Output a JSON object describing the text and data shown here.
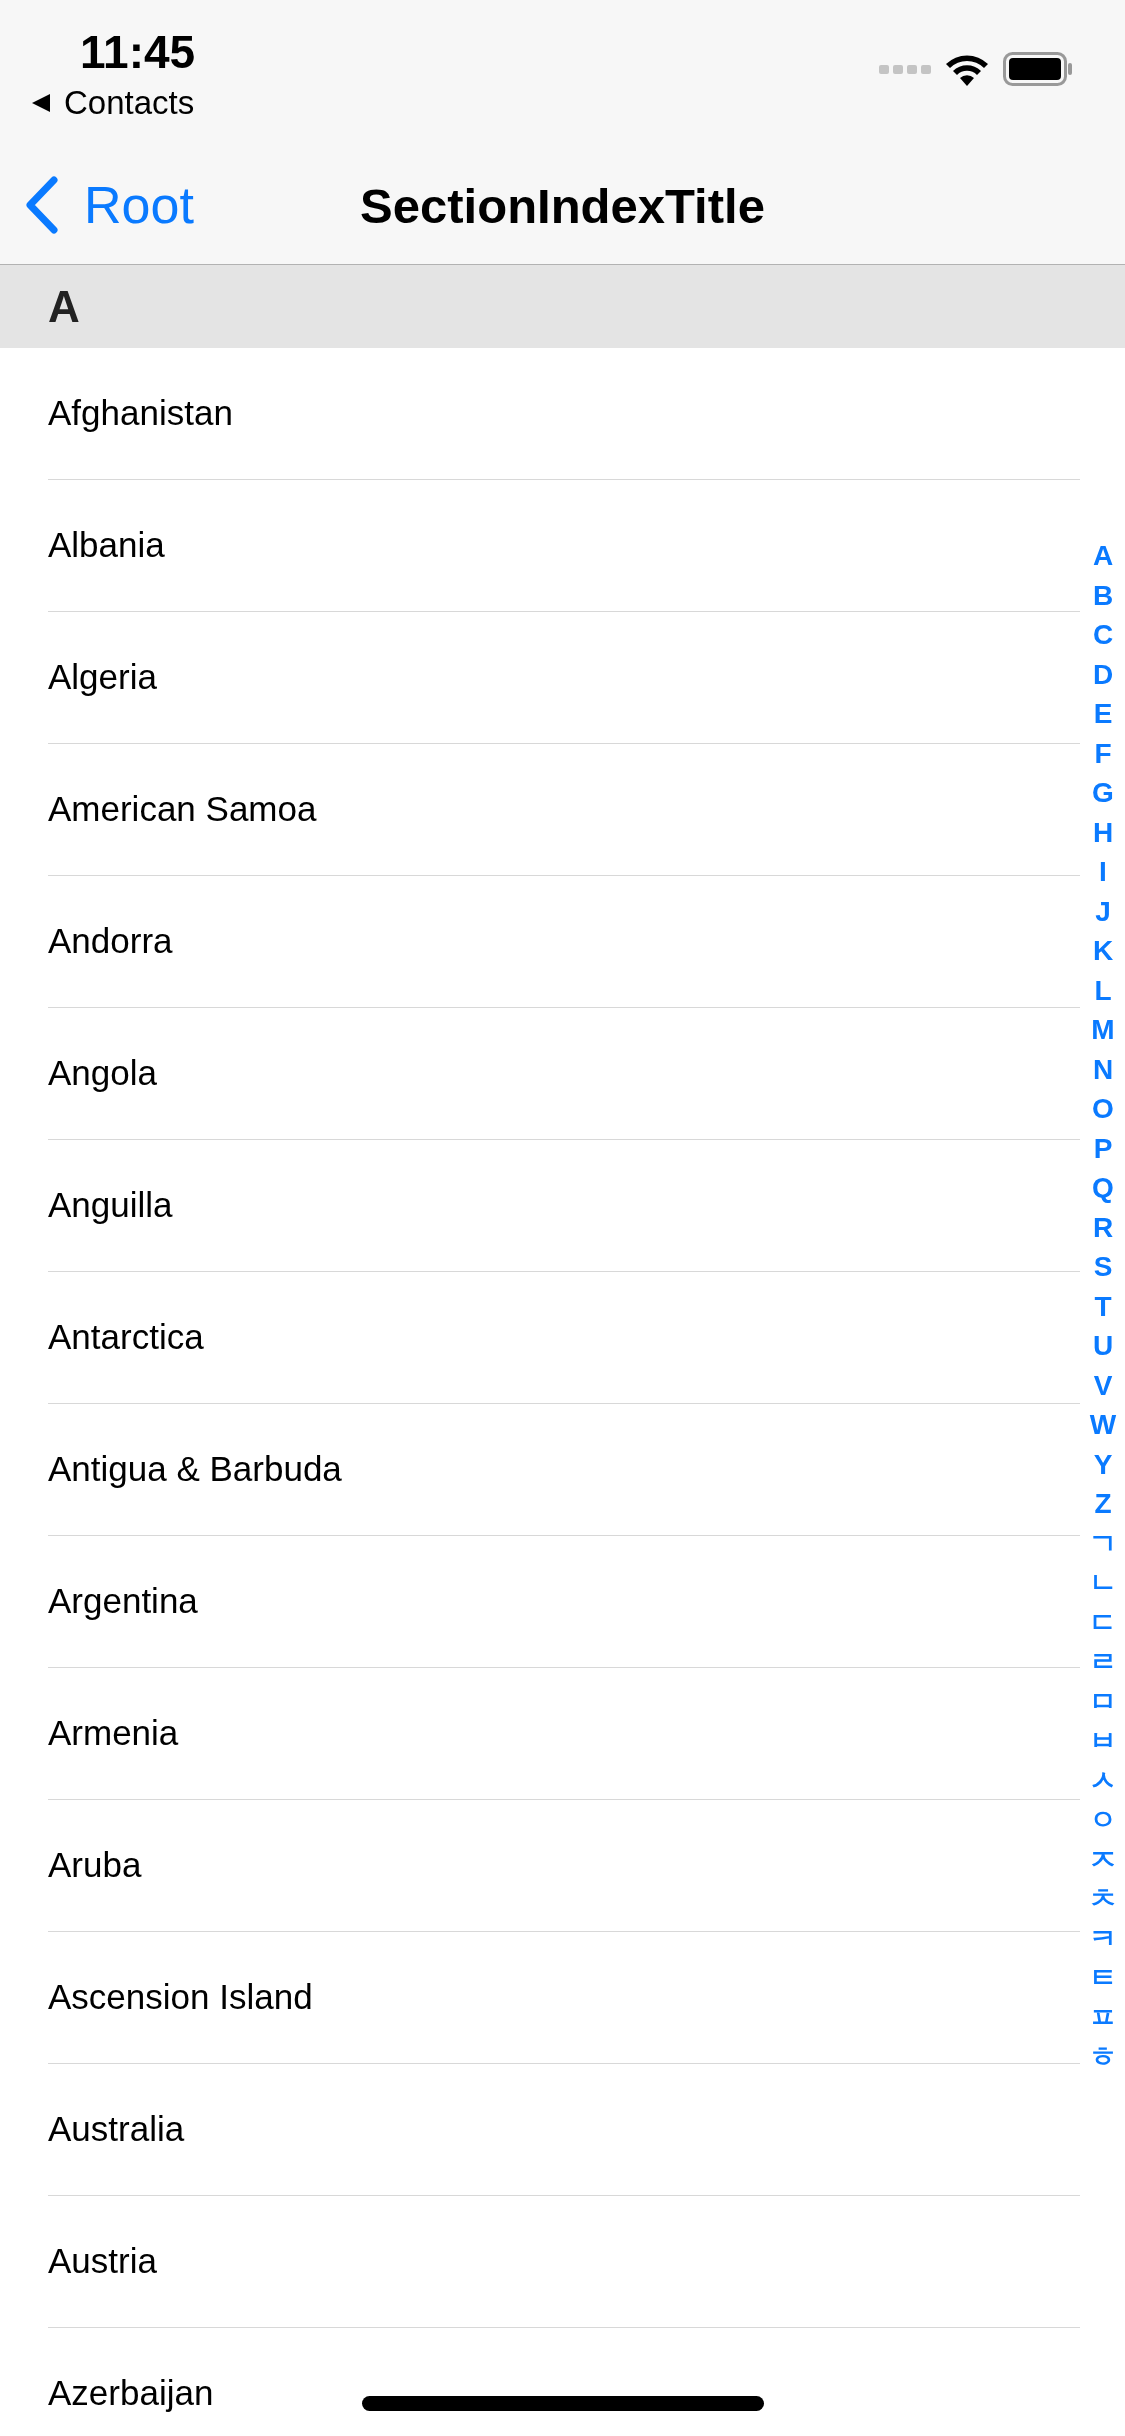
{
  "status_bar": {
    "time": "11:45",
    "back_app": "Contacts"
  },
  "nav_bar": {
    "back_label": "Root",
    "title": "SectionIndexTitle"
  },
  "sections": [
    {
      "header": "A",
      "rows": [
        "Afghanistan",
        "Albania",
        "Algeria",
        "American Samoa",
        "Andorra",
        "Angola",
        "Anguilla",
        "Antarctica",
        "Antigua & Barbuda",
        "Argentina",
        "Armenia",
        "Aruba",
        "Ascension Island",
        "Australia",
        "Austria",
        "Azerbaijan"
      ]
    }
  ],
  "section_index": [
    "A",
    "B",
    "C",
    "D",
    "E",
    "F",
    "G",
    "H",
    "I",
    "J",
    "K",
    "L",
    "M",
    "N",
    "O",
    "P",
    "Q",
    "R",
    "S",
    "T",
    "U",
    "V",
    "W",
    "Y",
    "Z",
    "ㄱ",
    "ㄴ",
    "ㄷ",
    "ㄹ",
    "ㅁ",
    "ㅂ",
    "ㅅ",
    "ㅇ",
    "ㅈ",
    "ㅊ",
    "ㅋ",
    "ㅌ",
    "ㅍ",
    "ㅎ"
  ]
}
